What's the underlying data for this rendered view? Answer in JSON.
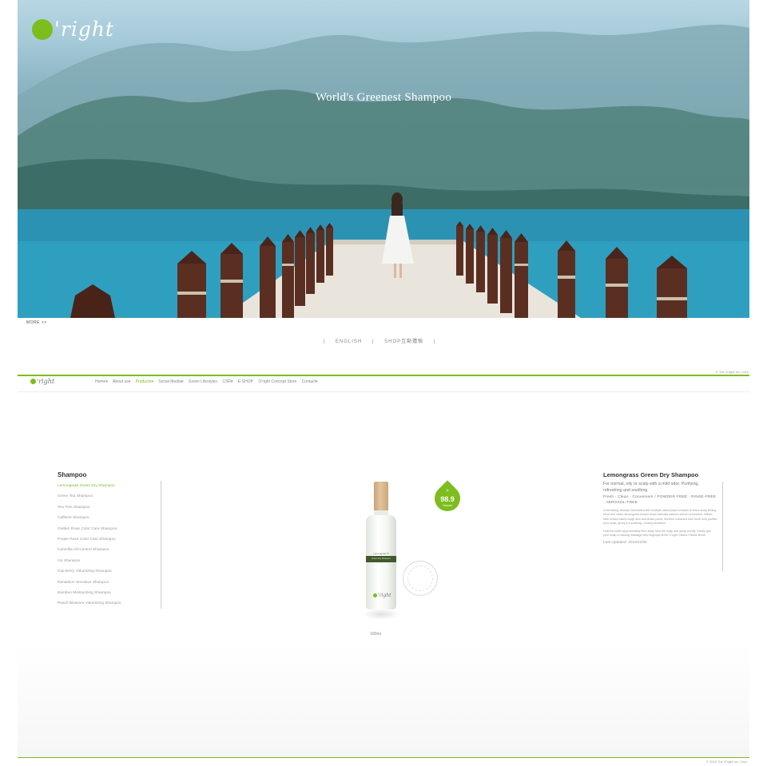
{
  "hero": {
    "logo_text": "'right",
    "title": "World's Greenest Shampoo",
    "more_link": "MORE >>",
    "languages": [
      "ENGLISH",
      "SHOP互動體驗"
    ]
  },
  "nav": {
    "logo_text": "'right",
    "items": [
      {
        "label": "Home▾"
      },
      {
        "label": "About us▾"
      },
      {
        "label": "Products▾"
      },
      {
        "label": "Social Media▾"
      },
      {
        "label": "Green Lifestyles"
      },
      {
        "label": "CSR▾"
      },
      {
        "label": "E-SHOP"
      },
      {
        "label": "O'right Concept Store"
      },
      {
        "label": "Contact▾"
      }
    ]
  },
  "sidebar": {
    "title": "Shampoo",
    "items": [
      {
        "label": "Lemongrass Green Dry Shampoo"
      },
      {
        "label": "Green Tea Shampoo"
      },
      {
        "label": "Tea Tree Shampoo"
      },
      {
        "label": "Caffeine Shampoo"
      },
      {
        "label": "Golden Rose Color Care Shampoo"
      },
      {
        "label": "Purple Rose Color Care Shampoo"
      },
      {
        "label": "Camellia Oil Control Shampoo"
      },
      {
        "label": "Ice Shampoo"
      },
      {
        "label": "Goji Berry Volumizing Shampoo"
      },
      {
        "label": "Dandelion Sensitive Shampoo"
      },
      {
        "label": "Bamboo Moisturizing Shampoo"
      },
      {
        "label": "Peach Blossom Volumizing Shampoo"
      }
    ]
  },
  "product": {
    "badge_arrow": ">",
    "badge_percent": "98.9",
    "badge_label": "Natural",
    "bottle_label_top": "Lemongrass ®",
    "bottle_label": "Green Dry Shampoo",
    "bottle_logo": "'right",
    "volume": "180ml"
  },
  "detail": {
    "title": "Lemongrass Green Dry Shampoo",
    "lead": "For normal, oily or scalp with a mild odor. Purifying, refreshing and soothing",
    "tags": "Fresh · Clean · Convenient / POWDER FREE · RINSE-FREE · AEROSOL-FREE",
    "para1": "A refreshing cleanser formulated with multiple natural plant extracts to leave scalp feeling fresh and clean; lemongrass extract helps naturally balance sebum production. Willow bark extract calms rough skin and clears pores. Menthol extracted from fresh mint purifies your scalp, giving it a soothing, cooling sensation.",
    "para2": "Hold the bottle approximately 5cm away from the scalp and spray evenly. Gently give your scalp a relaxing massage with fingertips at the O'right Classic Paddle Brush.",
    "date": "Last Updated: 2015/11/06"
  },
  "footer": {
    "copyright_top": "© The O'right Inc. Corp.",
    "copyright": "© 2015 The O'right Inc. Corp."
  }
}
